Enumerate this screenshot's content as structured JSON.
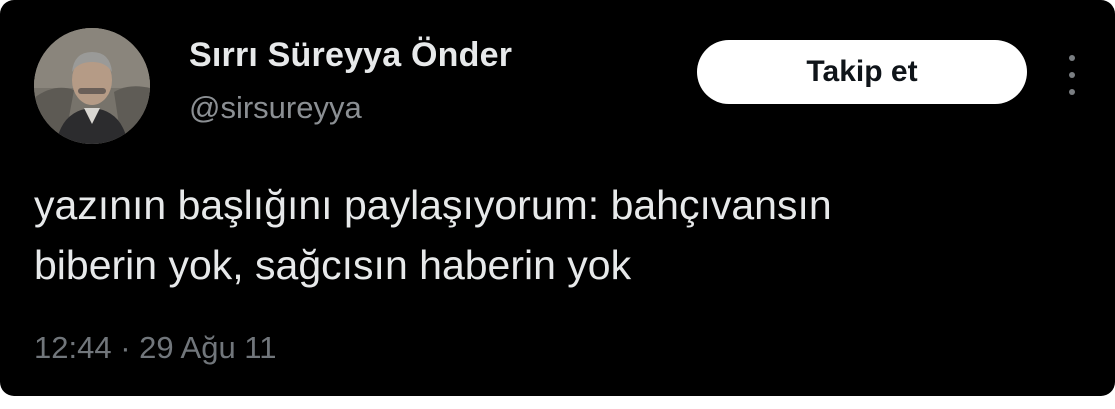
{
  "tweet": {
    "author": {
      "display_name": "Sırrı Süreyya Önder",
      "handle": "@sirsureyya"
    },
    "follow_button_label": "Takip et",
    "more_icon": "more-vertical-icon",
    "text_lines": [
      "yazının başlığını paylaşıyorum: bahçıvansın",
      "biberin yok, sağcısın haberin yok"
    ],
    "timestamp": {
      "time": "12:44",
      "separator": "·",
      "date": "29 Ağu 11"
    }
  },
  "colors": {
    "background": "#000000",
    "primary_text": "#e7e9ea",
    "secondary_text": "#71767b",
    "button_bg": "#ffffff",
    "button_text": "#0f1419"
  }
}
